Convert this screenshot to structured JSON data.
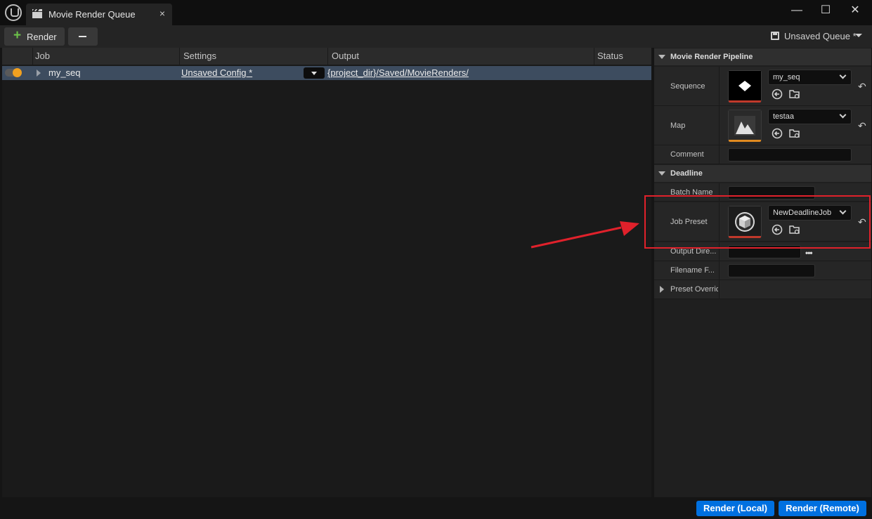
{
  "window": {
    "tab_title": "Movie Render Queue",
    "tab_close": "×",
    "minimize": "—",
    "maximize": "☐",
    "close": "✕"
  },
  "toolbar": {
    "render_label": "Render",
    "queue_name": "Unsaved Queue *"
  },
  "job_list": {
    "columns": [
      "Job",
      "Settings",
      "Output",
      "Status"
    ],
    "rows": [
      {
        "enabled": true,
        "job": "my_seq",
        "settings": "Unsaved Config *",
        "output": "{project_dir}/Saved/MovieRenders/",
        "status": ""
      }
    ]
  },
  "details": {
    "movie_render_pipeline": {
      "title": "Movie Render Pipeline",
      "sequence_label": "Sequence",
      "sequence_value": "my_seq",
      "map_label": "Map",
      "map_value": "testaa",
      "comment_label": "Comment",
      "comment_value": ""
    },
    "deadline": {
      "title": "Deadline",
      "batch_name_label": "Batch Name",
      "batch_name_value": "",
      "job_preset_label": "Job Preset",
      "job_preset_value": "NewDeadlineJob",
      "output_dir_label": "Output Dire...",
      "output_dir_value": "",
      "filename_label": "Filename F...",
      "filename_value": "",
      "preset_overrides_label": "Preset Overric"
    }
  },
  "footer": {
    "render_local": "Render (Local)",
    "render_remote": "Render (Remote)"
  },
  "colors": {
    "accent_blue": "#0070e0",
    "toggle_on": "#f0a020",
    "add_green": "#6cc24a",
    "annotation_red": "#e0212b",
    "selected_row": "#3d4c5f"
  },
  "icons": [
    "unreal-logo-icon",
    "clapperboard-icon",
    "save-icon",
    "plus-icon",
    "minus-icon",
    "browse-to-asset-icon",
    "open-folder-icon",
    "reset-to-default-icon",
    "chevron-down-icon"
  ]
}
